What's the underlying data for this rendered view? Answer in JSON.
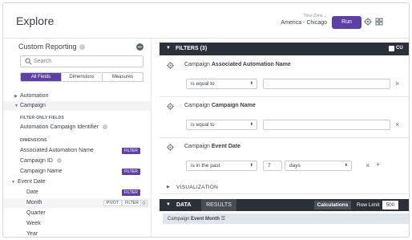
{
  "header": {
    "title": "Explore",
    "timezone_label": "Time Zone ⌄",
    "timezone_value": "America - Chicago",
    "run_label": "Run",
    "accent_color": "#5d3fa8"
  },
  "sidebar": {
    "title": "Custom Reporting",
    "search_placeholder": "Search",
    "tabs": [
      {
        "label": "All Fields",
        "active": true
      },
      {
        "label": "Dimensions",
        "active": false
      },
      {
        "label": "Measures",
        "active": false
      }
    ],
    "groups": {
      "automation": "Automation",
      "campaign": "Campaign"
    },
    "sections": {
      "filter_only": "FILTER-ONLY FIELDS",
      "dimensions": "DIMENSIONS"
    },
    "fields": {
      "automation_campaign_identifier": "Automation Campaign Identifier",
      "associated_automation_name": "Associated Automation Name",
      "campaign_id": "Campaign ID",
      "campaign_name": "Campaign Name",
      "event_date": "Event Date",
      "date": "Date",
      "month": "Month",
      "quarter": "Quarter",
      "week": "Week",
      "year": "Year"
    },
    "badges": {
      "filter": "FILTER",
      "pivot": "PIVOT"
    }
  },
  "filters": {
    "header_label": "FILTERS (3)",
    "corner_label": "CU",
    "items": [
      {
        "prefix": "Campaign",
        "name": "Associated Automation Name",
        "operator": "is equal to",
        "value": ""
      },
      {
        "prefix": "Campaign",
        "name": "Campaign Name",
        "operator": "is equal to",
        "value": ""
      },
      {
        "prefix": "Campaign",
        "name": "Event Date",
        "operator": "is in the past",
        "value": "7",
        "unit": "days"
      }
    ],
    "add_symbol": "+",
    "remove_symbol": "×"
  },
  "visualization": {
    "label": "VISUALIZATION"
  },
  "data_panel": {
    "data_label": "DATA",
    "results_label": "RESULTS",
    "calculations_label": "Calculations",
    "row_limit_label": "Row Limit",
    "row_limit_value": "500",
    "column_prefix": "Campaign",
    "column_name": "Event Month"
  }
}
